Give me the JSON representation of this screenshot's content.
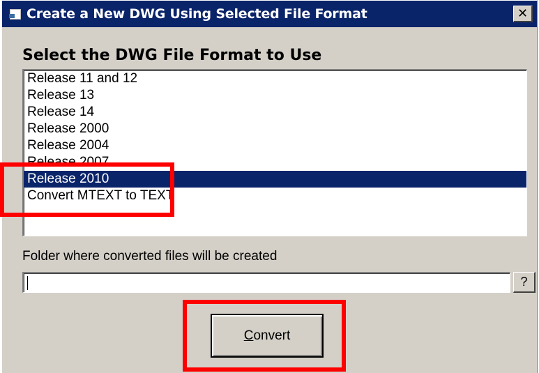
{
  "window": {
    "title": "Create a New DWG Using Selected File Format",
    "close_label": "x"
  },
  "heading": "Select the DWG File Format to Use",
  "formats": {
    "items": [
      {
        "label": "Release 11 and 12"
      },
      {
        "label": "Release 13"
      },
      {
        "label": "Release 14"
      },
      {
        "label": "Release 2000"
      },
      {
        "label": "Release 2004"
      },
      {
        "label": "Release 2007"
      },
      {
        "label": "Release 2010"
      },
      {
        "label": "Convert MTEXT to TEXT"
      }
    ],
    "selected": "Release 2010"
  },
  "folder": {
    "label": "Folder where converted files will be created",
    "value": "",
    "browse_label": "?"
  },
  "convert_button": {
    "label": "Convert"
  },
  "colors": {
    "title_bar": "#0a246a",
    "selection": "#0a246a",
    "dialog_face": "#d4d0c8",
    "highlight_annotation": "#ff0000"
  }
}
